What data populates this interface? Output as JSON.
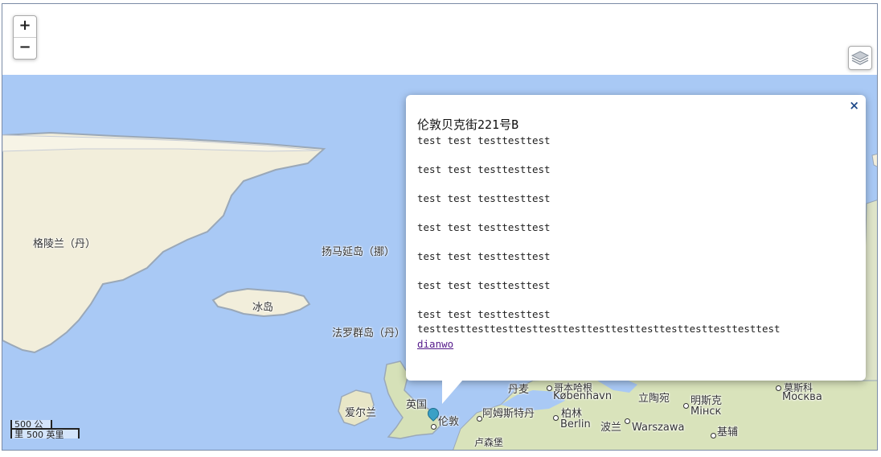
{
  "controls": {
    "zoom_in": "+",
    "zoom_out": "−",
    "layers_icon": "layers-icon"
  },
  "labels": {
    "greenland": "格陵兰（丹）",
    "jan_mayen": "扬马延岛（挪）",
    "iceland": "冰岛",
    "faroe": "法罗群岛（丹）",
    "ireland": "爱尔兰",
    "uk": "英国",
    "london": "伦敦",
    "amsterdam": "阿姆斯特丹",
    "denmark": "丹麦",
    "copenhagen_cn": "哥本哈根",
    "copenhagen": "København",
    "berlin_cn": "柏林",
    "berlin": "Berlin",
    "lithuania": "立陶宛",
    "minsk_cn": "明斯克",
    "minsk": "Мінск",
    "poland": "波兰",
    "warsaw": "Warszawa",
    "kyiv": "基辅",
    "moscow_cn": "莫斯科",
    "moscow": "Москва",
    "luxembourg": "卢森堡"
  },
  "scale": {
    "metric": "500 公里",
    "imperial": "500 英里"
  },
  "popup": {
    "close": "×",
    "title": "伦敦贝克街221号B",
    "lines": [
      "test test testtesttest",
      "test test testtesttest",
      "test test testtesttest",
      "test test testtesttest",
      "test test testtesttest",
      "test test testtesttest",
      "test test testtesttest"
    ],
    "long_line": "testtesttesttesttesttesttesttesttesttesttesttesttesttesttest",
    "link": "dianwo"
  },
  "colors": {
    "sea": "#a9c9f5",
    "land": "#f2eedb",
    "ice": "#f7f4e6",
    "coast": "#9aa8b8",
    "marker": "#3aa0c6"
  }
}
